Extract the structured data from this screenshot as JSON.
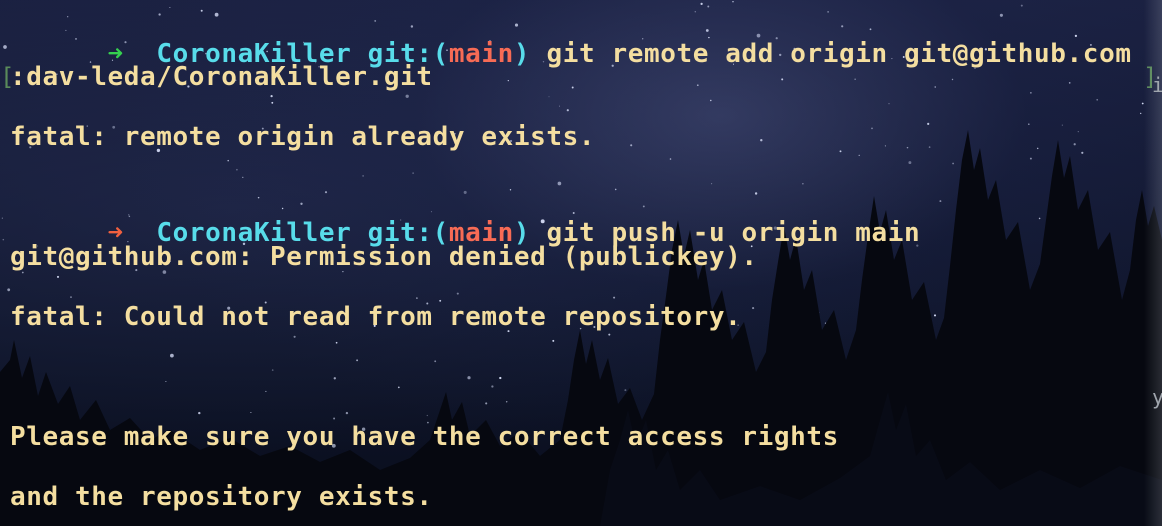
{
  "colors": {
    "success_arrow": "#35d04f",
    "error_arrow": "#f0603f",
    "directory": "#58dcea",
    "branch": "#f76b55",
    "text": "#f4dea0"
  },
  "terminal": {
    "lines": [
      {
        "type": "prompt",
        "status": "success",
        "arrow": "➜",
        "dir": "CoronaKiller",
        "git_label": "git:(",
        "branch": "main",
        "git_close": ")",
        "command": "git remote add origin git@github.com"
      },
      {
        "type": "text",
        "text": ":dav-leda/CoronaKiller.git"
      },
      {
        "type": "text",
        "text": "fatal: remote origin already exists."
      },
      {
        "type": "prompt",
        "status": "error",
        "arrow": "➜",
        "dir": "CoronaKiller",
        "git_label": "git:(",
        "branch": "main",
        "git_close": ")",
        "command": "git push -u origin main"
      },
      {
        "type": "text",
        "text": "git@github.com: Permission denied (publickey)."
      },
      {
        "type": "text",
        "text": "fatal: Could not read from remote repository."
      },
      {
        "type": "text",
        "text": ""
      },
      {
        "type": "text",
        "text": "Please make sure you have the correct access rights"
      },
      {
        "type": "text",
        "text": "and the repository exists."
      }
    ]
  }
}
